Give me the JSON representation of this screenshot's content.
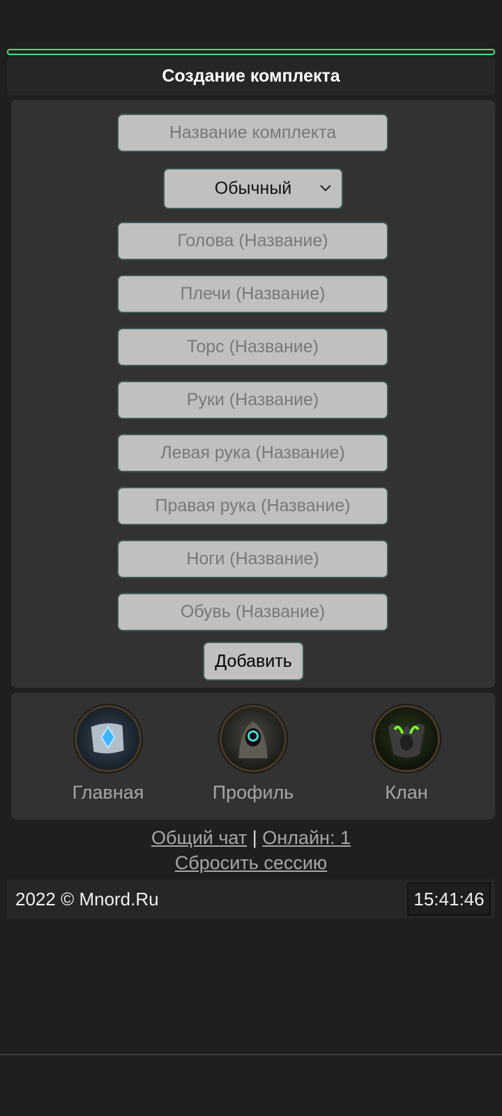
{
  "header": {
    "title": "Создание комплекта"
  },
  "form": {
    "set_name_placeholder": "Название комплекта",
    "rarity_select": {
      "selected": "Обычный"
    },
    "fields": [
      {
        "placeholder": "Голова (Название)"
      },
      {
        "placeholder": "Плечи (Название)"
      },
      {
        "placeholder": "Торс (Название)"
      },
      {
        "placeholder": "Руки (Название)"
      },
      {
        "placeholder": "Левая рука (Название)"
      },
      {
        "placeholder": "Правая рука (Название)"
      },
      {
        "placeholder": "Ноги (Название)"
      },
      {
        "placeholder": "Обувь (Название)"
      }
    ],
    "submit_label": "Добавить"
  },
  "nav": {
    "items": [
      {
        "label": "Главная",
        "icon": "scroll-crystal-icon"
      },
      {
        "label": "Профиль",
        "icon": "hooded-figure-icon"
      },
      {
        "label": "Клан",
        "icon": "green-demon-icon"
      }
    ]
  },
  "links": {
    "chat": "Общий чат",
    "separator": "|",
    "online": "Онлайн: 1",
    "reset_session": "Сбросить сессию"
  },
  "footer": {
    "copyright": "2022 © Mnord.Ru",
    "clock": "15:41:46"
  },
  "colors": {
    "background": "#1f1f1f",
    "panel": "#323232",
    "progress_border": "#4ade80",
    "field_bg": "#c0c0c0",
    "field_border": "#3d5a55"
  }
}
